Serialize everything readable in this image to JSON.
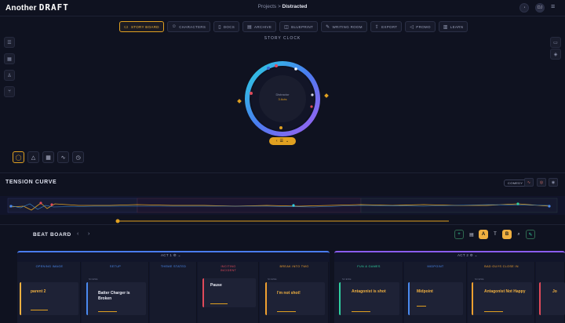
{
  "app": {
    "logo_left": "Another",
    "logo_right": "DRAFT",
    "breadcrumb_root": "Projects",
    "breadcrumb_sep": ">",
    "breadcrumb_current": "Distracted",
    "avatar_initials": "DJ"
  },
  "tabs": [
    {
      "label": "STORY BOARD",
      "icon": "monitor-icon"
    },
    {
      "label": "CHARACTERS",
      "icon": "people-icon"
    },
    {
      "label": "DOCS",
      "icon": "doc-icon"
    },
    {
      "label": "ARCHIVE",
      "icon": "archive-icon"
    },
    {
      "label": "BLUEPRINT",
      "icon": "blueprint-icon"
    },
    {
      "label": "WRITING ROOM",
      "icon": "pen-icon"
    },
    {
      "label": "EXPORT",
      "icon": "export-icon"
    },
    {
      "label": "PROMO",
      "icon": "megaphone-icon"
    },
    {
      "label": "LEARN",
      "icon": "book-icon"
    }
  ],
  "story_clock": {
    "title": "STORY CLOCK",
    "center_label": "Distractor",
    "center_value": "3 Acts",
    "pill_label": "☰"
  },
  "tension": {
    "title": "TENSION CURVE",
    "genre": "COMEDY",
    "progress": 0.8
  },
  "beat_board": {
    "title": "BEAT BOARD",
    "acts": [
      {
        "label": "ACT 1",
        "color": "#4a7cf0"
      },
      {
        "label": "ACT 2",
        "color": "#8a5cf0"
      }
    ],
    "columns": [
      {
        "header": "OPENING IMAGE",
        "color": "#4a8af0"
      },
      {
        "header": "SETUP",
        "color": "#4a8af0"
      },
      {
        "header": "THEME STATED",
        "color": "#4a8af0"
      },
      {
        "header": "INCITING INCIDENT",
        "color": "#e04a5a"
      },
      {
        "header": "BREAK INTO TWO",
        "color": "#f0a030"
      },
      {
        "header": "FUN & GAMES",
        "color": "#30d0a0"
      },
      {
        "header": "MIDPOINT",
        "color": "#4a8af0"
      },
      {
        "header": "BAD GUYS CLOSE IN",
        "color": "#f0a030"
      }
    ],
    "cards": [
      {
        "scene": "",
        "text": "parent 2",
        "color": "#f0b040"
      },
      {
        "scene": "SCENE",
        "text": "Batter Charger is Broken",
        "color": "#e9ebf5"
      },
      {
        "scene": "",
        "text": "Pause",
        "color": "#e9ebf5"
      },
      {
        "scene": "SCENE",
        "text": "I'm not shot!",
        "color": "#f0b040"
      },
      {
        "scene": "SCENE",
        "text": "Antagonist is shot",
        "color": "#f0b040"
      },
      {
        "scene": "",
        "text": "Midpoint",
        "color": "#f0b040"
      },
      {
        "scene": "SCENE",
        "text": "Antagonist Not Happy",
        "color": "#f0b040"
      },
      {
        "scene": "",
        "text": "Jo",
        "color": "#f0b040"
      }
    ]
  }
}
